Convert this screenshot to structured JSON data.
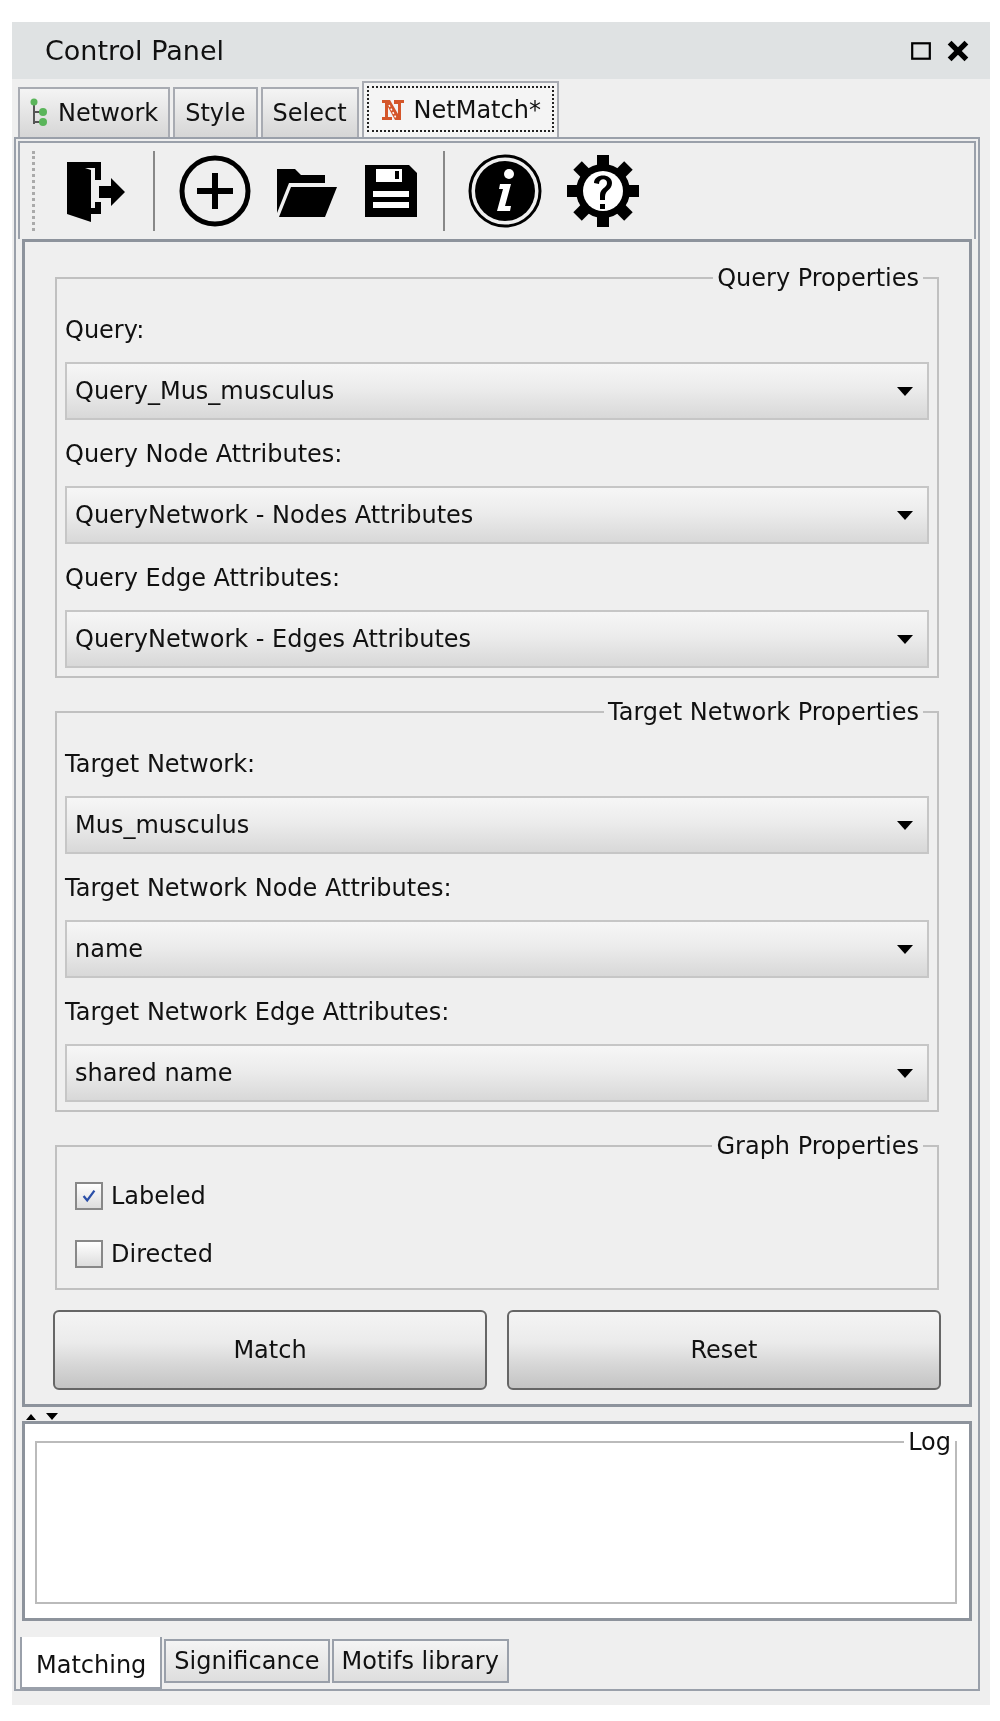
{
  "window": {
    "title": "Control Panel"
  },
  "tabs": [
    {
      "label": "Network",
      "kind": "tree",
      "selected": false
    },
    {
      "label": "Style",
      "kind": "plain",
      "selected": false
    },
    {
      "label": "Select",
      "kind": "plain",
      "selected": false
    },
    {
      "label": "NetMatch*",
      "kind": "netmatch",
      "selected": true
    }
  ],
  "groups": [
    {
      "title": "Query Properties",
      "fields": [
        {
          "label": "Query:",
          "value": "Query_Mus_musculus"
        },
        {
          "label": "Query Node Attributes:",
          "value": "QueryNetwork - Nodes Attributes"
        },
        {
          "label": "Query Edge Attributes:",
          "value": "QueryNetwork - Edges Attributes"
        }
      ]
    },
    {
      "title": "Target Network Properties",
      "fields": [
        {
          "label": "Target Network:",
          "value": "Mus_musculus"
        },
        {
          "label": "Target Network Node Attributes:",
          "value": "name"
        },
        {
          "label": "Target Network Edge Attributes:",
          "value": "shared name"
        }
      ]
    },
    {
      "title": "Graph Properties",
      "checkboxes": [
        {
          "label": "Labeled",
          "checked": true
        },
        {
          "label": "Directed",
          "checked": false
        }
      ]
    }
  ],
  "buttons": [
    "Match",
    "Reset"
  ],
  "log": {
    "title": "Log"
  },
  "bottom_tabs": [
    {
      "label": "Matching",
      "selected": true
    },
    {
      "label": "Significance",
      "selected": false
    },
    {
      "label": "Motifs library",
      "selected": false
    }
  ]
}
